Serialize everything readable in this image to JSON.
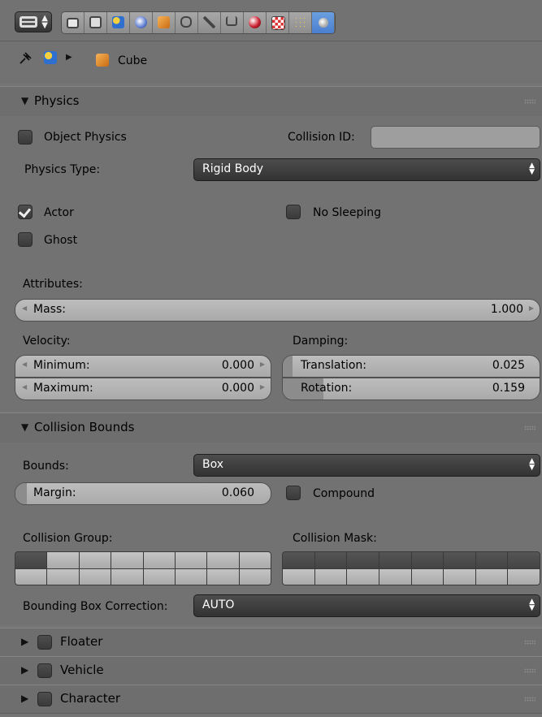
{
  "toolbar": {
    "context_icon": "properties-editor-icon",
    "tab_icons": [
      "render-icon",
      "render-layers-icon",
      "scene-icon",
      "world-icon",
      "object-icon",
      "constraints-icon",
      "modifiers-icon",
      "data-icon",
      "material-icon",
      "texture-icon",
      "particles-icon",
      "physics-icon"
    ],
    "active_tab": "physics-icon"
  },
  "breadcrumb": {
    "object_name": "Cube"
  },
  "physics": {
    "title": "Physics",
    "object_physics_label": "Object Physics",
    "collision_id_label": "Collision ID:",
    "collision_id_value": "",
    "physics_type_label": "Physics Type:",
    "physics_type_value": "Rigid Body",
    "actor_label": "Actor",
    "actor_checked": true,
    "no_sleeping_label": "No Sleeping",
    "ghost_label": "Ghost",
    "attributes_label": "Attributes:",
    "mass_label": "Mass:",
    "mass_value": "1.000",
    "velocity_label": "Velocity:",
    "min_label": "Minimum:",
    "min_value": "0.000",
    "max_label": "Maximum:",
    "max_value": "0.000",
    "damping_label": "Damping:",
    "translation_label": "Translation:",
    "translation_value": "0.025",
    "translation_fraction": 0.025,
    "rotation_label": "Rotation:",
    "rotation_value": "0.159",
    "rotation_fraction": 0.159
  },
  "collision": {
    "title": "Collision Bounds",
    "bounds_label": "Bounds:",
    "bounds_value": "Box",
    "margin_label": "Margin:",
    "margin_value": "0.060",
    "compound_label": "Compound",
    "group_label": "Collision Group:",
    "mask_label": "Collision Mask:",
    "group_active_cells": [
      0
    ],
    "mask_active_cells": [
      0,
      1,
      2,
      3,
      4,
      5,
      6,
      7
    ],
    "bbox_label": "Bounding Box Correction:",
    "bbox_value": "AUTO"
  },
  "collapsed_panels": {
    "floater": "Floater",
    "vehicle": "Vehicle",
    "character": "Character"
  }
}
